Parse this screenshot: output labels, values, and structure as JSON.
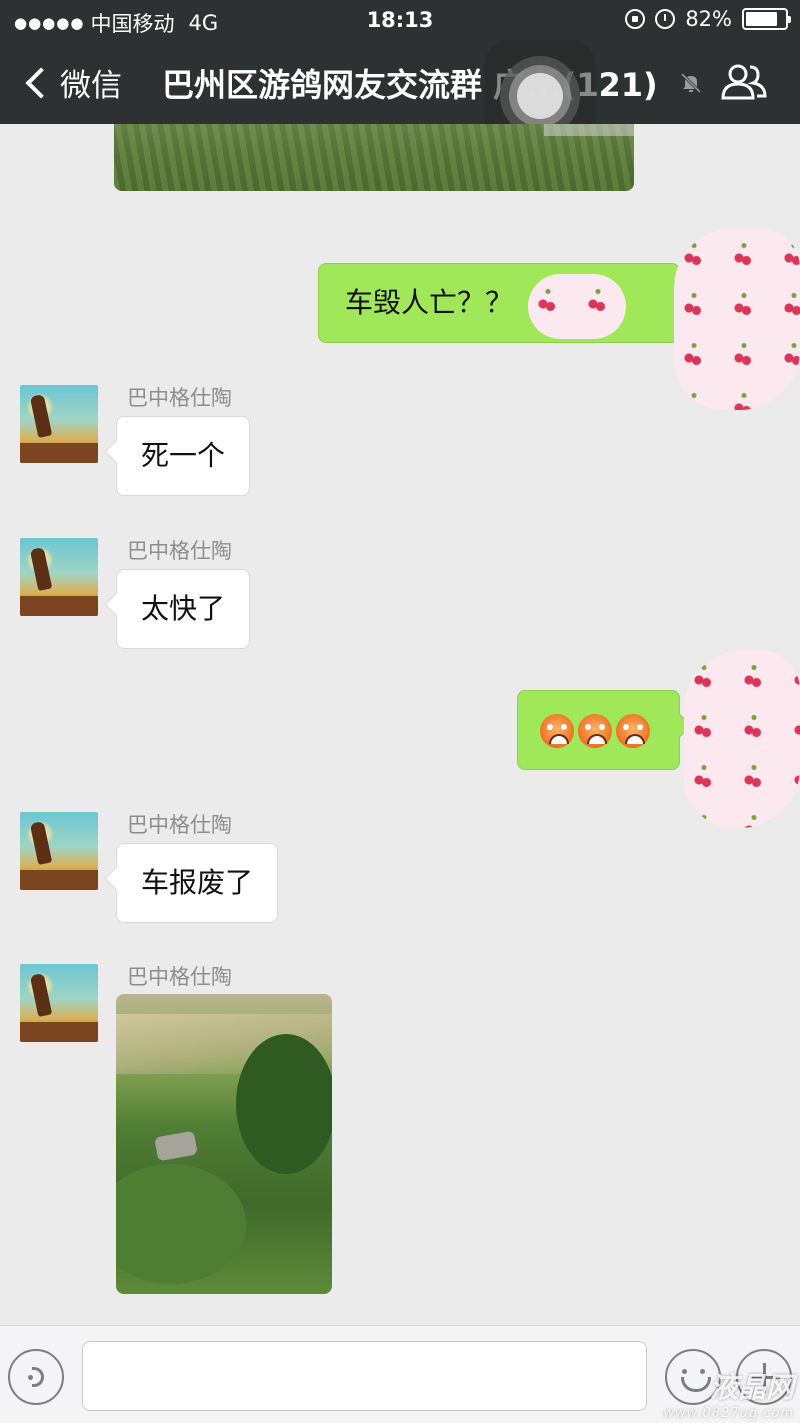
{
  "status_bar": {
    "signal": "●●●●●",
    "carrier": "中国移动",
    "network": "4G",
    "time": "18:13",
    "battery_percent": "82%",
    "battery_level": 0.82
  },
  "nav": {
    "back_label": "微信",
    "title": "巴州区游鸽网友交流群 广...(121)",
    "mute_icon": "bell-slash-icon",
    "group_icon": "group-members-icon"
  },
  "messages": [
    {
      "type": "image",
      "side": "left",
      "description": "grass photo (partially visible)"
    },
    {
      "type": "text",
      "side": "right",
      "text": "车毁人亡？？",
      "trailing": "。"
    },
    {
      "type": "text",
      "side": "left",
      "sender": "巴中格仕陶",
      "text": "死一个"
    },
    {
      "type": "text",
      "side": "left",
      "sender": "巴中格仕陶",
      "text": "太快了"
    },
    {
      "type": "emoji",
      "side": "right",
      "emoji": [
        "angry-face",
        "angry-face",
        "angry-face"
      ]
    },
    {
      "type": "text",
      "side": "left",
      "sender": "巴中格仕陶",
      "text": "车报废了"
    },
    {
      "type": "image",
      "side": "left",
      "sender": "巴中格仕陶"
    }
  ],
  "input_bar": {
    "voice_icon": "voice-icon",
    "emoji_icon": "emoji-icon",
    "plus_icon": "plus-icon"
  },
  "watermark": {
    "main": "液晶网",
    "sub": "www.0827ug.com"
  }
}
